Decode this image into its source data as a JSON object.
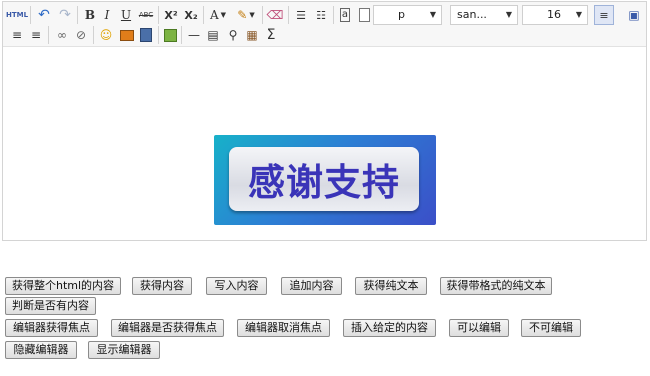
{
  "toolbar": {
    "html_label": "HTML",
    "font_color_letter": "A",
    "format_value": "p",
    "font_family_value": "san...",
    "font_size_value": "16",
    "sum_glyph": "Σ"
  },
  "content": {
    "image_text": "感谢支持"
  },
  "buttons": {
    "get_all_html": "获得整个html的内容",
    "get_content": "获得内容",
    "write_content": "写入内容",
    "append_content": "追加内容",
    "get_plain_text": "获得纯文本",
    "get_formatted_text": "获得带格式的纯文本",
    "has_content": "判断是否有内容",
    "focus_editor": "编辑器获得焦点",
    "is_focused": "编辑器是否获得焦点",
    "blur_editor": "编辑器取消焦点",
    "insert_content": "插入给定的内容",
    "enable_edit": "可以编辑",
    "disable_edit": "不可编辑",
    "hide_editor": "隐藏编辑器",
    "show_editor": "显示编辑器"
  }
}
